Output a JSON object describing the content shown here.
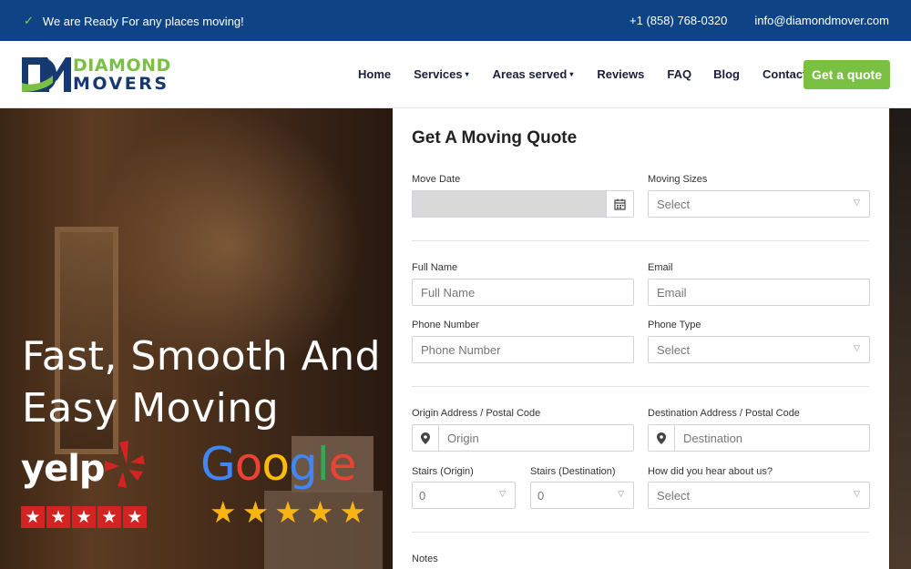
{
  "topbar": {
    "tagline": "We are Ready For any places moving!",
    "phone": "+1 (858) 768-0320",
    "email": "info@diamondmover.com"
  },
  "brand": {
    "line1": "DIAMOND",
    "line2": "MOVERS",
    "green": "#7ac143",
    "navy": "#163a70"
  },
  "nav": {
    "items": [
      {
        "label": "Home",
        "dropdown": false
      },
      {
        "label": "Services",
        "dropdown": true
      },
      {
        "label": "Areas served",
        "dropdown": true
      },
      {
        "label": "Reviews",
        "dropdown": false
      },
      {
        "label": "FAQ",
        "dropdown": false
      },
      {
        "label": "Blog",
        "dropdown": false
      },
      {
        "label": "Contact",
        "dropdown": false
      }
    ],
    "cta": "Get a quote"
  },
  "hero": {
    "headline_line1": "Fast, Smooth And",
    "headline_line2": "Easy Moving",
    "yelp_word": "yelp",
    "yelp_stars": 5,
    "google_word": "Google",
    "google_stars": 5
  },
  "form": {
    "title": "Get A Moving Quote",
    "move_date": {
      "label": "Move Date",
      "value": "",
      "icon": "calendar-icon"
    },
    "moving_sizes": {
      "label": "Moving Sizes",
      "value": "Select"
    },
    "full_name": {
      "label": "Full Name",
      "placeholder": "Full Name"
    },
    "email": {
      "label": "Email",
      "placeholder": "Email"
    },
    "phone": {
      "label": "Phone Number",
      "placeholder": "Phone Number"
    },
    "phone_type": {
      "label": "Phone Type",
      "value": "Select"
    },
    "origin": {
      "label": "Origin Address / Postal Code",
      "placeholder": "Origin",
      "icon": "map-pin-icon"
    },
    "destination": {
      "label": "Destination Address / Postal Code",
      "placeholder": "Destination",
      "icon": "map-pin-icon"
    },
    "stairs_origin": {
      "label": "Stairs (Origin)",
      "value": "0"
    },
    "stairs_destination": {
      "label": "Stairs (Destination)",
      "value": "0"
    },
    "heard_about": {
      "label": "How did you hear about us?",
      "value": "Select"
    },
    "notes": {
      "label": "Notes"
    }
  }
}
